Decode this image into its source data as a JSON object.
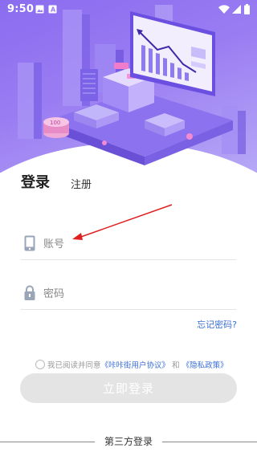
{
  "status_bar": {
    "time": "9:50",
    "left_icons": [
      "image-icon",
      "a-box-icon"
    ],
    "right_icons": [
      "wifi-icon",
      "signal-icon",
      "battery-icon"
    ]
  },
  "tabs": {
    "login": "登录",
    "register": "注册"
  },
  "account_field": {
    "placeholder": "账号",
    "value": "",
    "icon": "phone-icon"
  },
  "password_field": {
    "placeholder": "密码",
    "value": "",
    "icon": "lock-icon"
  },
  "forgot_password": "忘记密码?",
  "agreement": {
    "checked": false,
    "prefix": "我已阅读并同意",
    "user_agreement": "《咔咔街用户协议》",
    "conjunction": "和",
    "privacy_policy": "《隐私政策》"
  },
  "login_button": "立即登录",
  "third_party_label": "第三方登录",
  "colors": {
    "hero_gradient_start": "#8a6cf0",
    "hero_gradient_end": "#b6a8f6",
    "link_blue": "#3b6fd6",
    "button_disabled": "#e4e4e4",
    "annotation_arrow": "#e02020"
  }
}
